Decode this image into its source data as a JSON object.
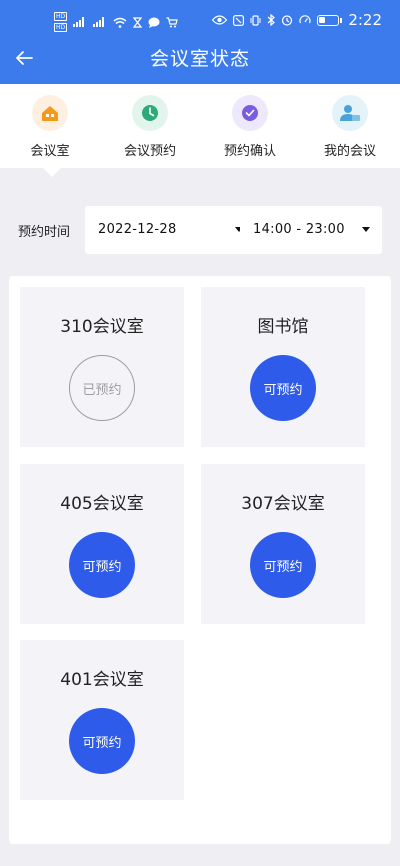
{
  "status_bar": {
    "hd1": "HD",
    "hd2": "HD",
    "signal1": "⁴⁶",
    "signal2": "⁴⁶",
    "time": "2:22"
  },
  "header": {
    "back_icon": "arrow-left-icon",
    "title": "会议室状态"
  },
  "tabs": [
    {
      "label": "会议室",
      "icon": "house-icon",
      "color": "#f39a1d",
      "bg": "#fdf0e0"
    },
    {
      "label": "会议预约",
      "icon": "clock-icon",
      "color": "#2daa78",
      "bg": "#e2f5ec"
    },
    {
      "label": "预约确认",
      "icon": "check-icon",
      "color": "#7a5ce0",
      "bg": "#ede8fb"
    },
    {
      "label": "我的会议",
      "icon": "person-icon",
      "color": "#4aa3d8",
      "bg": "#e4f2fa"
    }
  ],
  "booking": {
    "time_label": "预约时间",
    "date_value": "2022-12-28",
    "time_range_value": "14:00 - 23:00"
  },
  "rooms": [
    {
      "name": "310会议室",
      "status": "已预约",
      "available": false
    },
    {
      "name": "图书馆",
      "status": "可预约",
      "available": true
    },
    {
      "name": "405会议室",
      "status": "可预约",
      "available": true
    },
    {
      "name": "307会议室",
      "status": "可预约",
      "available": true
    },
    {
      "name": "401会议室",
      "status": "可预约",
      "available": true
    }
  ],
  "colors": {
    "header": "#3b7bec",
    "available_button": "#2f5bea",
    "booked_border": "#9e9e9e"
  }
}
